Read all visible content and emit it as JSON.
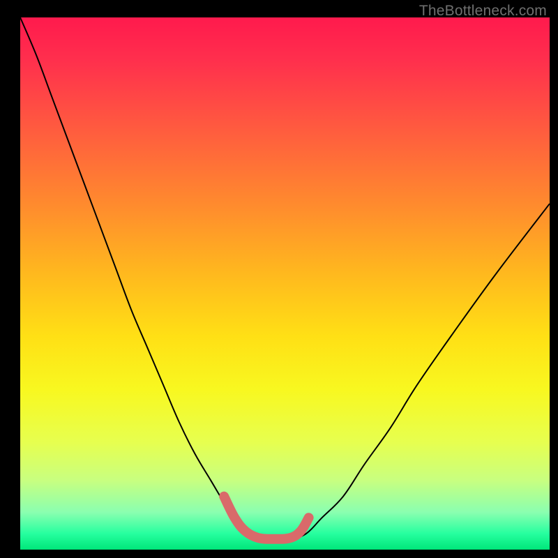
{
  "watermark": {
    "text": "TheBottleneck.com"
  },
  "layout": {
    "border_left": 29,
    "border_right": 12,
    "border_top": 25,
    "border_bottom": 12,
    "watermark_right": 16,
    "watermark_top": 4,
    "watermark_font_px": 21
  },
  "colors": {
    "curve": "#000000",
    "highlight": "#d96a6a",
    "background_black": "#000000"
  },
  "chart_data": {
    "type": "line",
    "title": "",
    "xlabel": "",
    "ylabel": "",
    "xlim": [
      0,
      100
    ],
    "ylim": [
      0,
      100
    ],
    "y_axis_inverted_note": "screen y grows downward; values below are in percent of plot height from top",
    "series": [
      {
        "name": "main-curve",
        "x": [
          0,
          3,
          6,
          9,
          12,
          15,
          18,
          21,
          24,
          27,
          30,
          33,
          36,
          39,
          41,
          43,
          45,
          48,
          51,
          54,
          57,
          61,
          65,
          70,
          75,
          82,
          90,
          100
        ],
        "y": [
          0,
          7,
          15,
          23,
          31,
          39,
          47,
          55,
          62,
          69,
          76,
          82,
          87,
          92,
          95,
          97,
          98,
          98,
          98,
          97,
          94,
          90,
          84,
          77,
          69,
          59,
          48,
          35
        ]
      },
      {
        "name": "highlighted-min-segment",
        "x": [
          38.5,
          40.5,
          42.5,
          45,
          48,
          51,
          53,
          54.5
        ],
        "y": [
          90,
          94,
          96.5,
          97.8,
          98,
          97.8,
          96.5,
          94
        ]
      }
    ],
    "annotations": []
  }
}
